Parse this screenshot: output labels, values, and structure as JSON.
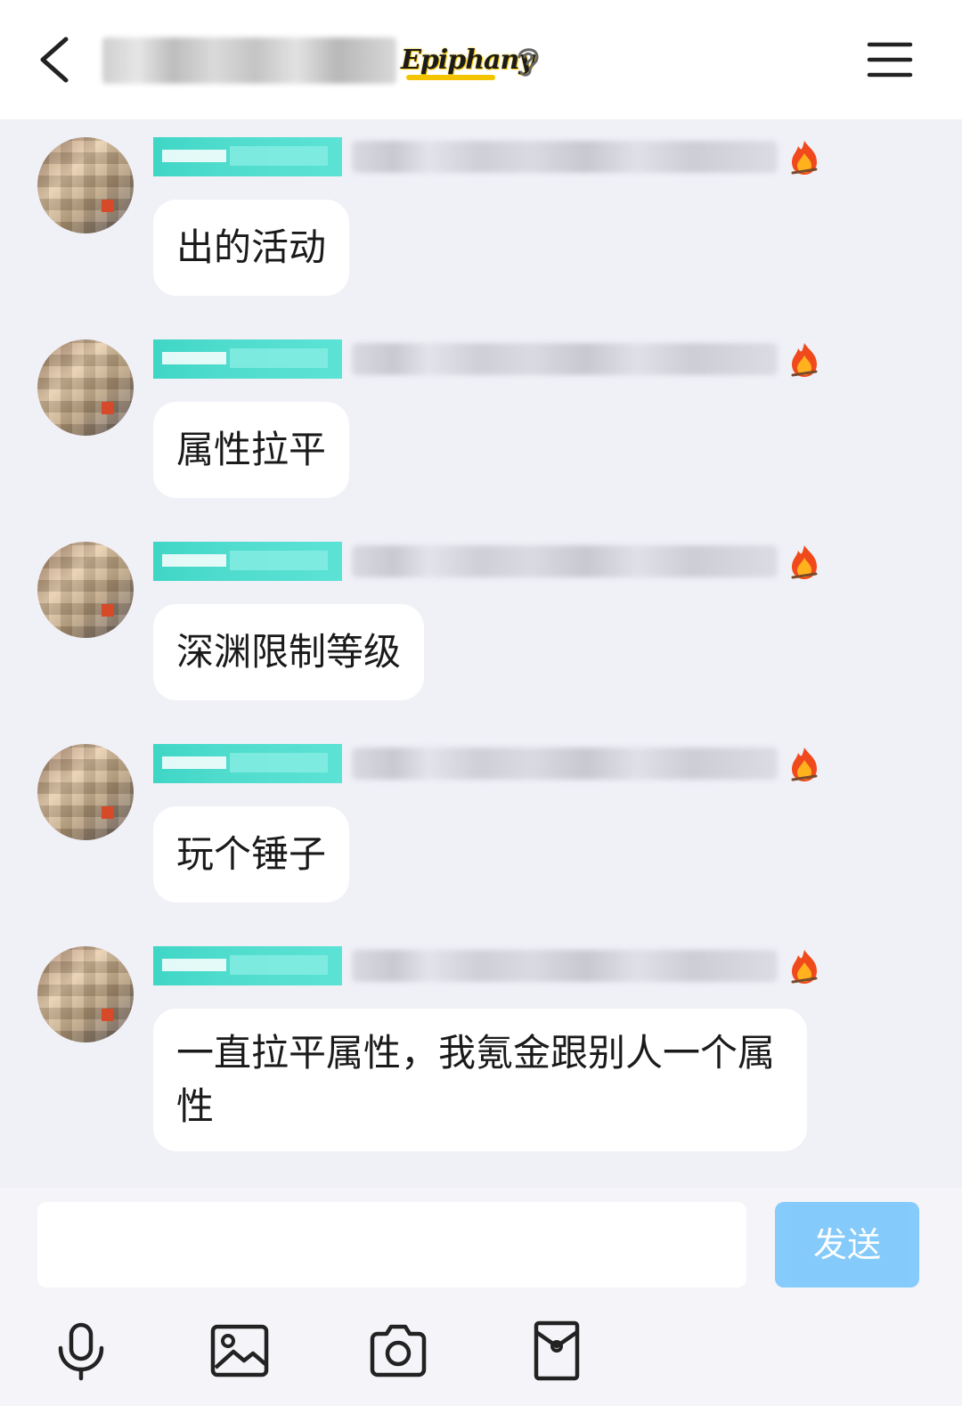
{
  "header": {
    "title": "█▇▆ ▅▇▆▅▇▆▅▇",
    "badge": "Epiphany"
  },
  "messages": [
    {
      "tag": "▆▆▆ ▇▇▇▇",
      "meta": "▓▓▓ ▓▓▓▓▓▓ ▓▓ ▓▓▓▓",
      "text": "出的活动"
    },
    {
      "tag": "▆▆▆ ▇▇▇▇",
      "meta": "▓▓▓ ▓▓▓▓▓▓ ▓▓ ▓▓▓▓",
      "text": "属性拉平"
    },
    {
      "tag": "▆▆▆ ▇▇▇▇",
      "meta": "▓▓▓ ▓▓▓▓▓▓ ▓▓ ▓▓▓▓",
      "text": "深渊限制等级"
    },
    {
      "tag": "▆▆▆ ▇▇▇▇",
      "meta": "▓▓▓ ▓▓▓▓▓▓ ▓▓ ▓▓▓▓",
      "text": "玩个锤子"
    },
    {
      "tag": "▆▆▆ ▇▇▇▇",
      "meta": "▓▓▓ ▓▓▓▓▓▓ ▓▓ ▓▓▓▓",
      "text": "一直拉平属性，我氪金跟别人一个属性"
    }
  ],
  "composer": {
    "input_value": "",
    "send_label": "发送"
  },
  "icons": {
    "back": "chevron-left-icon",
    "menu": "hamburger-menu-icon",
    "ear": "ear-icon",
    "fire": "fire-icon",
    "mic": "microphone-icon",
    "image": "image-icon",
    "camera": "camera-icon",
    "red_packet": "red-envelope-icon"
  },
  "colors": {
    "tag": "#3fd6c5",
    "send_button": "#7ec8fb",
    "badge_accent": "#f5c400"
  }
}
